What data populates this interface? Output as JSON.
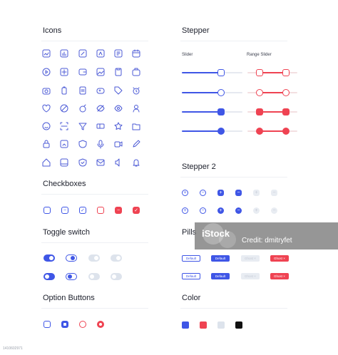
{
  "sections": {
    "icons": "Icons",
    "stepper": "Stepper",
    "checkboxes": "Checkboxes",
    "stepper2": "Stepper 2",
    "toggle": "Toggle switch",
    "pills": "Pills",
    "option_buttons": "Option Buttons",
    "color": "Color"
  },
  "stepper_labels": {
    "slider": "Slider",
    "range_slider": "Range Slider"
  },
  "pills": {
    "row1": [
      "Default",
      "Default",
      "Ghost ×",
      "Ghost ×"
    ],
    "row2": [
      "Default",
      "Default",
      "Ghost ×",
      "Ghost ×"
    ]
  },
  "stepper2": {
    "plus": "+",
    "minus": "−"
  },
  "checkbox_marks": {
    "indeterminate": "−",
    "checked": "✓"
  },
  "colors": {
    "accent": "#3f56e6",
    "red": "#ef4352",
    "light": "#dde3ec",
    "black": "#111111",
    "outline": "#3f56e6"
  },
  "icon_names": [
    [
      "chart-icon",
      "bar-chart-icon",
      "edit-icon",
      "compass-icon",
      "document-icon",
      "calendar-icon"
    ],
    [
      "play-icon",
      "add-icon",
      "wallet-icon",
      "image-icon",
      "paste-icon",
      "briefcase-icon"
    ],
    [
      "camera-icon",
      "battery-icon",
      "file-icon",
      "game-icon",
      "tag-icon",
      "alarm-icon"
    ],
    [
      "heart-icon",
      "block-icon",
      "bomb-icon",
      "eye-off-icon",
      "eye-icon",
      "user-icon"
    ],
    [
      "emoji-icon",
      "scan-icon",
      "filter-icon",
      "ticket-icon",
      "star-icon",
      "folder-icon"
    ],
    [
      "home-icon",
      "image-frame-icon",
      "shield-icon",
      "mic-icon",
      "video-icon",
      "pencil-icon"
    ],
    [
      "house-icon",
      "frame-icon",
      "badge-icon",
      "mail-icon",
      "speaker-icon",
      "bell-icon"
    ]
  ],
  "watermark": {
    "brand": "iStock",
    "credit": "Credit: dmitryfet"
  },
  "stock_id": "1410602971"
}
